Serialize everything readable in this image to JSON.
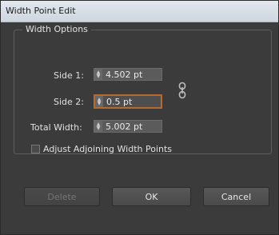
{
  "window": {
    "title": "Width Point Edit"
  },
  "width_options": {
    "label": "Width Options",
    "side1": {
      "label": "Side 1:",
      "value": "4.502 pt"
    },
    "side2": {
      "label": "Side 2:",
      "value": "0.5 pt"
    },
    "total_width": {
      "label": "Total Width:",
      "value": "5.002 pt"
    },
    "adjust_checkbox": {
      "label": "Adjust Adjoining Width Points",
      "checked": false
    }
  },
  "buttons": {
    "delete": "Delete",
    "ok": "OK",
    "cancel": "Cancel"
  },
  "colors": {
    "dialog_bg": "#3b3b3b",
    "field_bg": "#5b5b5b",
    "focus_border": "#b36b2e"
  }
}
